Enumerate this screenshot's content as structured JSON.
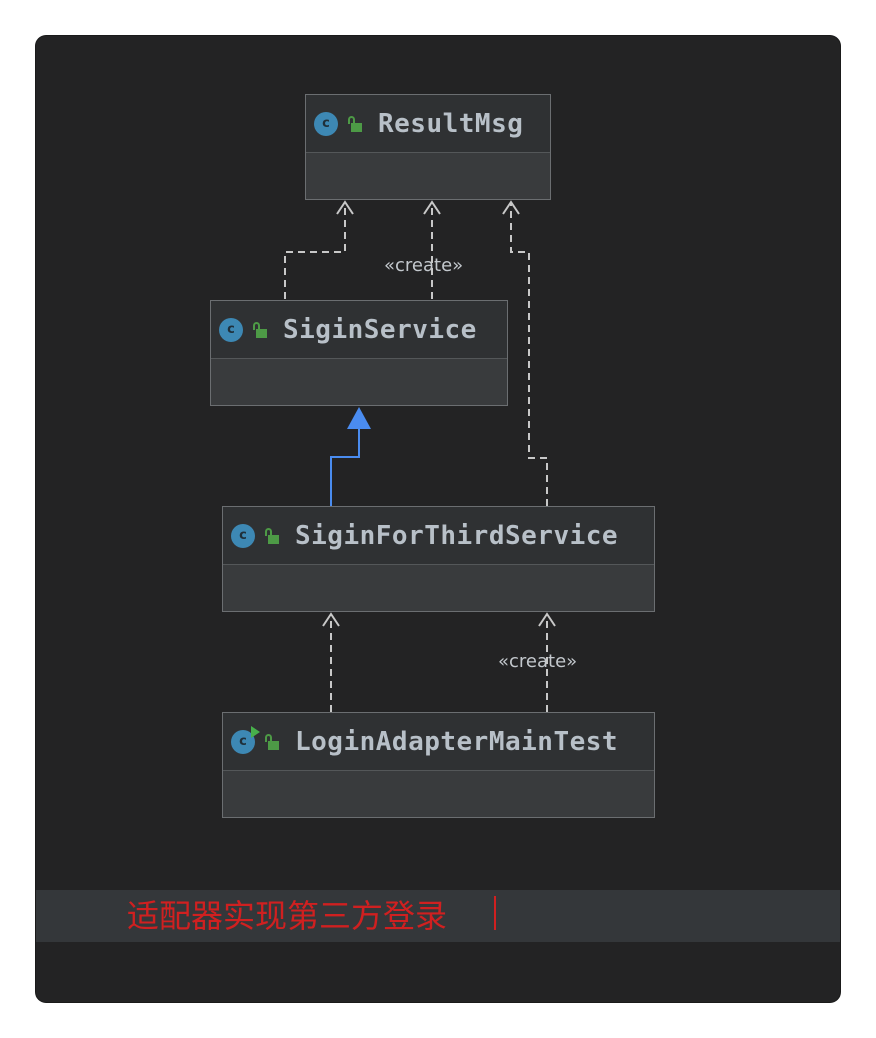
{
  "diagram": {
    "classes": [
      {
        "id": "result_msg",
        "name": "ResultMsg",
        "kind": "class"
      },
      {
        "id": "sigin_service",
        "name": "SiginService",
        "kind": "class"
      },
      {
        "id": "sigin_for_third_service",
        "name": "SiginForThirdService",
        "kind": "class"
      },
      {
        "id": "login_adapter_main_test",
        "name": "LoginAdapterMainTest",
        "kind": "class-with-main"
      }
    ],
    "relations": [
      {
        "from": "SiginService",
        "to": "ResultMsg",
        "type": "dependency",
        "label": ""
      },
      {
        "from": "SiginService",
        "to": "ResultMsg",
        "type": "dependency",
        "label": "«create»"
      },
      {
        "from": "SiginForThirdService",
        "to": "ResultMsg",
        "type": "dependency",
        "label": ""
      },
      {
        "from": "SiginForThirdService",
        "to": "SiginService",
        "type": "generalization",
        "label": ""
      },
      {
        "from": "LoginAdapterMainTest",
        "to": "SiginForThirdService",
        "type": "dependency",
        "label": ""
      },
      {
        "from": "LoginAdapterMainTest",
        "to": "SiginForThirdService",
        "type": "dependency",
        "label": "«create»"
      }
    ],
    "icon_names": [
      "class-icon",
      "public-access-icon",
      "run-class-icon"
    ],
    "colors": {
      "background": "#232324",
      "node_header": "#2f3133",
      "node_border": "#6b6e71",
      "dependency_line": "#c8c8c8",
      "generalization_line": "#4a8cf0",
      "caption": "#d02020"
    }
  },
  "caption": {
    "text": "适配器实现第三方登录"
  }
}
